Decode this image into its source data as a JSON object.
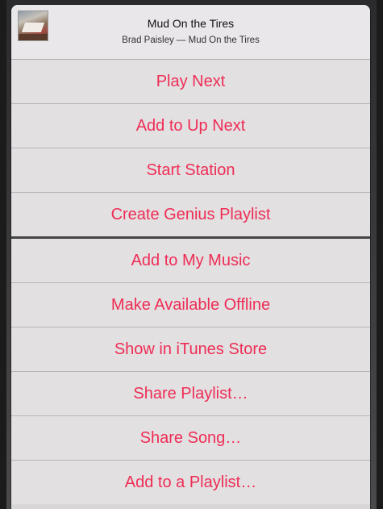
{
  "now_playing": {
    "title": "Mud On the Tires",
    "subtitle": "Brad Paisley — Mud On the Tires",
    "artwork_icon": "album-artwork"
  },
  "menu": {
    "group_one": [
      {
        "label": "Play Next",
        "name": "play-next-button"
      },
      {
        "label": "Add to Up Next",
        "name": "add-to-up-next-button"
      },
      {
        "label": "Start Station",
        "name": "start-station-button"
      },
      {
        "label": "Create Genius Playlist",
        "name": "create-genius-playlist-button"
      }
    ],
    "group_two": [
      {
        "label": "Add to My Music",
        "name": "add-to-my-music-button"
      },
      {
        "label": "Make Available Offline",
        "name": "make-available-offline-button"
      },
      {
        "label": "Show in iTunes Store",
        "name": "show-in-itunes-store-button"
      },
      {
        "label": "Share Playlist…",
        "name": "share-playlist-button"
      },
      {
        "label": "Share Song…",
        "name": "share-song-button"
      },
      {
        "label": "Add to a Playlist…",
        "name": "add-to-a-playlist-button"
      }
    ]
  },
  "colors": {
    "accent": "#ee2d55",
    "sheet_background": "#e3e0e2",
    "header_background": "#e9e7e9"
  }
}
